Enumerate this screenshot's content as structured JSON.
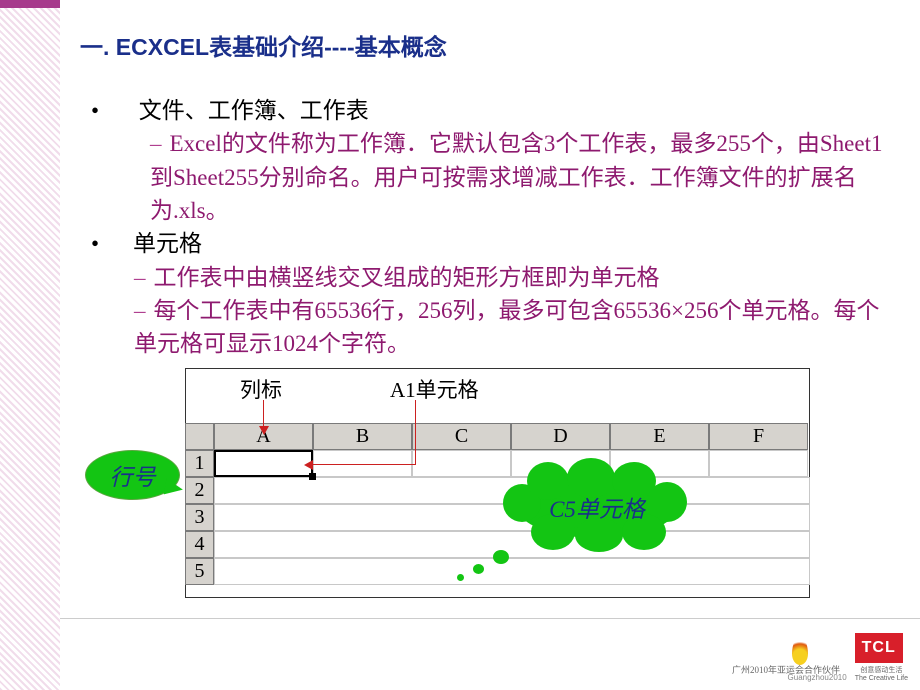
{
  "title": "一. ECXCEL表基础介绍----基本概念",
  "item1": {
    "label": "文件、工作簿、工作表",
    "sub1": "Excel的文件称为工作簿．它默认包含3个工作表，最多255个，由Sheet1到Sheet255分别命名。用户可按需求增减工作表．工作簿文件的扩展名为.xls。"
  },
  "item2": {
    "label": "单元格",
    "sub1": "工作表中由横竖线交叉组成的矩形方框即为单元格",
    "sub2": "每个工作表中有65536行，256列，最多可包含65536×256个单元格。每个单元格可显示1024个字符。"
  },
  "diagram": {
    "col_label": "列标",
    "a1_label": "A1单元格",
    "row_label": "行号",
    "c5_label": "C5单元格",
    "columns": [
      "A",
      "B",
      "C",
      "D",
      "E",
      "F"
    ],
    "rows": [
      "1",
      "2",
      "3",
      "4",
      "5"
    ]
  },
  "footer": {
    "partner_text": "广州2010年亚运会合作伙伴",
    "brand": "TCL",
    "slogan_cn": "创意感动生活",
    "slogan_en": "The Creative Life",
    "gz": "Guangzhou2010"
  }
}
